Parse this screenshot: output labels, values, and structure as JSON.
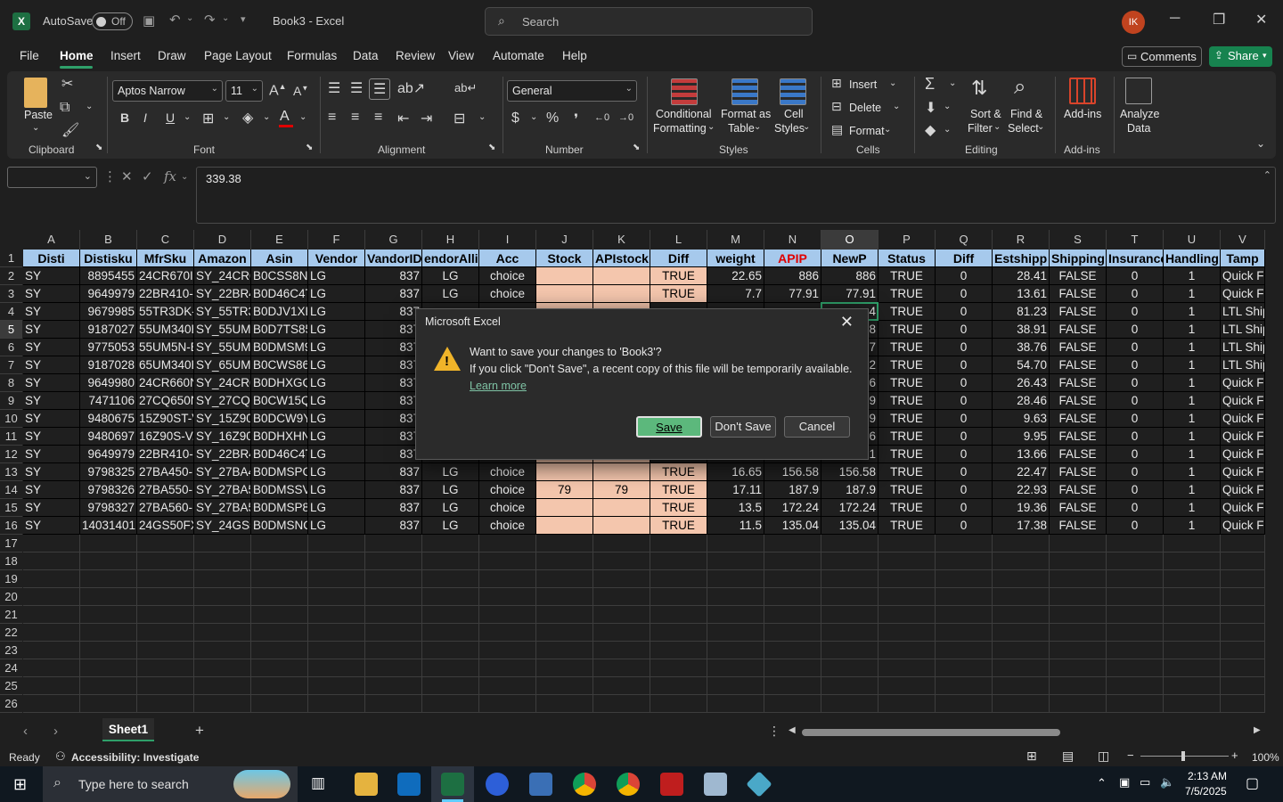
{
  "titlebar": {
    "autosave_label": "AutoSave",
    "autosave_state": "Off",
    "doc_title": "Book3  -  Excel",
    "search_placeholder": "Search",
    "avatar_initials": "IK"
  },
  "menu": {
    "items": [
      "File",
      "Home",
      "Insert",
      "Draw",
      "Page Layout",
      "Formulas",
      "Data",
      "Review",
      "View",
      "Automate",
      "Help"
    ],
    "active": "Home",
    "comments_label": "Comments",
    "share_label": "Share"
  },
  "ribbon": {
    "clipboard": {
      "paste": "Paste",
      "label": "Clipboard"
    },
    "font": {
      "name": "Aptos Narrow",
      "size": "11",
      "label": "Font"
    },
    "alignment": {
      "label": "Alignment"
    },
    "number": {
      "format": "General",
      "label": "Number"
    },
    "styles": {
      "conditional": "Conditional",
      "formatting": "Formatting",
      "format_as": "Format as",
      "table": "Table",
      "cell": "Cell",
      "cell_styles": "Styles",
      "label": "Styles"
    },
    "cells": {
      "insert": "Insert",
      "delete": "Delete",
      "format": "Format",
      "label": "Cells"
    },
    "editing": {
      "sort": "Sort &",
      "filter": "Filter",
      "find": "Find &",
      "select": "Select",
      "label": "Editing"
    },
    "addins": {
      "addins": "Add-ins",
      "label": "Add-ins",
      "analyze1": "Analyze",
      "analyze2": "Data"
    }
  },
  "formula_bar": {
    "namebox": "",
    "value": "339.38"
  },
  "sheet": {
    "columns": [
      "A",
      "B",
      "C",
      "D",
      "E",
      "F",
      "G",
      "H",
      "I",
      "J",
      "K",
      "L",
      "M",
      "N",
      "O",
      "P",
      "Q",
      "R",
      "S",
      "T",
      "U",
      "V"
    ],
    "selected_column": "O",
    "headers": [
      "Disti",
      "Distisku",
      "MfrSku",
      "Amazon",
      "Asin",
      "Vendor",
      "VandorID",
      "endorAllia",
      "Acc",
      "Stock",
      "APIstock",
      "Diff",
      "weight",
      "APIP",
      "NewP",
      "Status",
      "Diff",
      "Estshipp",
      "Shipping",
      "Insurance",
      "Handling",
      "Tamp"
    ],
    "rows": [
      [
        "SY",
        "8895455",
        "24CR670IK",
        "SY_24CR67",
        "B0CSS8NK",
        "LG",
        "837",
        "LG",
        "choice",
        "",
        "",
        "TRUE",
        "22.65",
        "886",
        "886",
        "TRUE",
        "0",
        "28.41",
        "FALSE",
        "0",
        "1",
        "Quick F"
      ],
      [
        "SY",
        "9649979",
        "22BR410-B",
        "SY_22BR41",
        "B0D46C4T",
        "LG",
        "837",
        "LG",
        "choice",
        "",
        "",
        "TRUE",
        "7.7",
        "77.91",
        "77.91",
        "TRUE",
        "0",
        "13.61",
        "FALSE",
        "0",
        "1",
        "Quick F"
      ],
      [
        "SY",
        "9679985",
        "55TR3DK-B",
        "SY_55TR3D",
        "B0DJV1XH",
        "LG",
        "837",
        "",
        "",
        "",
        "",
        "",
        "",
        "",
        "4",
        "TRUE",
        "0",
        "81.23",
        "FALSE",
        "0",
        "1",
        "LTL Ship"
      ],
      [
        "SY",
        "9187027",
        "55UM340E",
        "SY_55UM3",
        "B0D7TS85",
        "LG",
        "837",
        "",
        "",
        "",
        "",
        "",
        "",
        "",
        "8",
        "TRUE",
        "0",
        "38.91",
        "FALSE",
        "0",
        "1",
        "LTL Ship"
      ],
      [
        "SY",
        "9775053",
        "55UM5N-B",
        "SY_55UM5",
        "B0DMSM9",
        "LG",
        "837",
        "",
        "",
        "",
        "",
        "",
        "",
        "",
        "7",
        "TRUE",
        "0",
        "38.76",
        "FALSE",
        "0",
        "1",
        "LTL Ship"
      ],
      [
        "SY",
        "9187028",
        "65UM340E",
        "SY_65UM3",
        "B0CWS86L",
        "LG",
        "837",
        "",
        "",
        "",
        "",
        "",
        "",
        "",
        "2",
        "TRUE",
        "0",
        "54.70",
        "FALSE",
        "0",
        "1",
        "LTL Ship"
      ],
      [
        "SY",
        "9649980",
        "24CR660N",
        "SY_24CR66",
        "B0DHXGQ",
        "LG",
        "837",
        "",
        "",
        "",
        "",
        "",
        "",
        "",
        "6",
        "TRUE",
        "0",
        "26.43",
        "FALSE",
        "0",
        "1",
        "Quick F"
      ],
      [
        "SY",
        "7471106",
        "27CQ650N",
        "SY_27CQ6",
        "B0CW15Q",
        "LG",
        "837",
        "",
        "",
        "",
        "",
        "",
        "",
        "",
        "9",
        "TRUE",
        "0",
        "28.46",
        "FALSE",
        "0",
        "1",
        "Quick F"
      ],
      [
        "SY",
        "9480675",
        "15Z90ST-V",
        "SY_15Z90S",
        "B0DCW9Y",
        "LG",
        "837",
        "",
        "",
        "",
        "",
        "",
        "",
        "",
        "9",
        "TRUE",
        "0",
        "9.63",
        "FALSE",
        "0",
        "1",
        "Quick F"
      ],
      [
        "SY",
        "9480697",
        "16Z90S-V.",
        "SY_16Z90S",
        "B0DHXHN",
        "LG",
        "837",
        "",
        "",
        "",
        "",
        "",
        "",
        "",
        "6",
        "TRUE",
        "0",
        "9.95",
        "FALSE",
        "0",
        "1",
        "Quick F"
      ],
      [
        "SY",
        "9649979",
        "22BR410-B",
        "SY_22BR41",
        "B0D46C4T",
        "LG",
        "837",
        "",
        "",
        "",
        "",
        "",
        "",
        "",
        "1",
        "TRUE",
        "0",
        "13.66",
        "FALSE",
        "0",
        "1",
        "Quick F"
      ],
      [
        "SY",
        "9798325",
        "27BA450-B",
        "SY_27BA45",
        "B0DMSPC",
        "LG",
        "837",
        "LG",
        "choice",
        "",
        "",
        "TRUE",
        "16.65",
        "156.58",
        "156.58",
        "TRUE",
        "0",
        "22.47",
        "FALSE",
        "0",
        "1",
        "Quick F"
      ],
      [
        "SY",
        "9798326",
        "27BA550-B",
        "SY_27BA55",
        "B0DMSSV",
        "LG",
        "837",
        "LG",
        "choice",
        "79",
        "79",
        "TRUE",
        "17.11",
        "187.9",
        "187.9",
        "TRUE",
        "0",
        "22.93",
        "FALSE",
        "0",
        "1",
        "Quick F"
      ],
      [
        "SY",
        "9798327",
        "27BA560-B",
        "SY_27BA56",
        "B0DMSP8",
        "LG",
        "837",
        "LG",
        "choice",
        "",
        "",
        "TRUE",
        "13.5",
        "172.24",
        "172.24",
        "TRUE",
        "0",
        "19.36",
        "FALSE",
        "0",
        "1",
        "Quick F"
      ],
      [
        "SY",
        "14031401",
        "24GS50FX",
        "SY_24GS50",
        "B0DMSNQ",
        "LG",
        "837",
        "LG",
        "choice",
        "",
        "",
        "TRUE",
        "11.5",
        "135.04",
        "135.04",
        "TRUE",
        "0",
        "17.38",
        "FALSE",
        "0",
        "1",
        "Quick F"
      ]
    ],
    "empty_rows": [
      "17",
      "18",
      "19",
      "20",
      "21",
      "22",
      "23",
      "24",
      "25",
      "26"
    ],
    "tab_name": "Sheet1"
  },
  "dialog": {
    "title": "Microsoft Excel",
    "message": "Want to save your changes to 'Book3'?",
    "detail": "If you click \"Don't Save\", a recent copy of this file will be temporarily available.",
    "learn_more": "Learn more",
    "save": "Save",
    "dont_save": "Don't Save",
    "cancel": "Cancel"
  },
  "statusbar": {
    "ready": "Ready",
    "accessibility": "Accessibility: Investigate",
    "zoom": "100%"
  },
  "taskbar": {
    "search_placeholder": "Type here to search",
    "time": "2:13 AM",
    "date": "7/5/2025"
  },
  "colors": {
    "header_fill": "#a6c9ec",
    "orange_fill": "#f4c6ad",
    "accent_green": "#2fa06a"
  }
}
